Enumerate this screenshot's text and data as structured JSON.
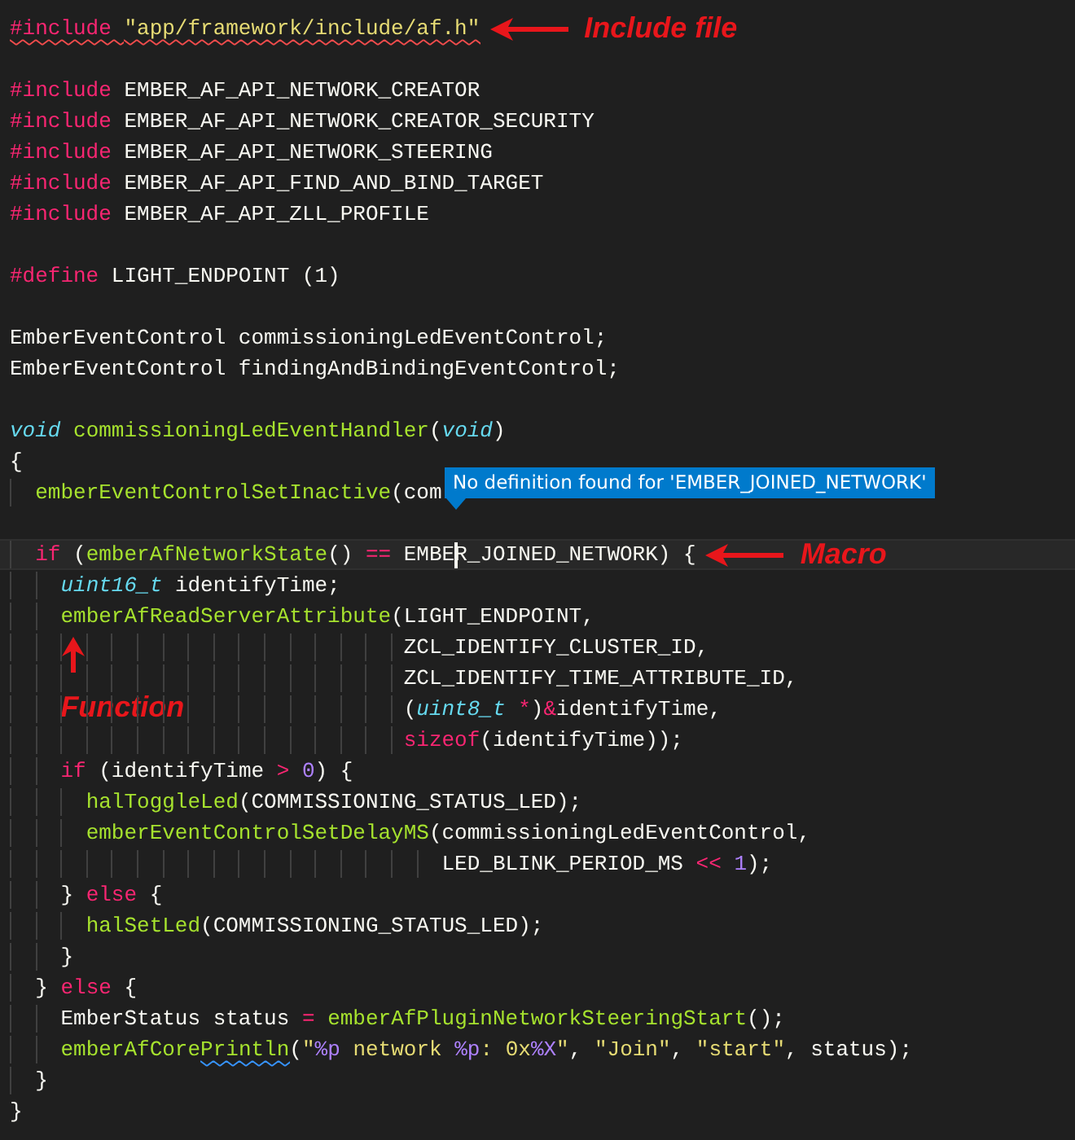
{
  "editor": {
    "lines": [
      {
        "kind": "code",
        "tokens": [
          {
            "text": "#include ",
            "kind": "directive",
            "error": true
          },
          {
            "text": "\"app/framework/include/af.h\"",
            "kind": "string",
            "error": true
          }
        ],
        "annotation": {
          "text": "Include file",
          "kind": "inline"
        }
      },
      {
        "kind": "blank"
      },
      {
        "kind": "code",
        "tokens": [
          {
            "text": "#include",
            "kind": "directive"
          },
          {
            "text": " EMBER_AF_API_NETWORK_CREATOR",
            "kind": "plain"
          }
        ]
      },
      {
        "kind": "code",
        "tokens": [
          {
            "text": "#include",
            "kind": "directive"
          },
          {
            "text": " EMBER_AF_API_NETWORK_CREATOR_SECURITY",
            "kind": "plain"
          }
        ]
      },
      {
        "kind": "code",
        "tokens": [
          {
            "text": "#include",
            "kind": "directive"
          },
          {
            "text": " EMBER_AF_API_NETWORK_STEERING",
            "kind": "plain"
          }
        ]
      },
      {
        "kind": "code",
        "tokens": [
          {
            "text": "#include",
            "kind": "directive"
          },
          {
            "text": " EMBER_AF_API_FIND_AND_BIND_TARGET",
            "kind": "plain"
          }
        ]
      },
      {
        "kind": "code",
        "tokens": [
          {
            "text": "#include",
            "kind": "directive"
          },
          {
            "text": " EMBER_AF_API_ZLL_PROFILE",
            "kind": "plain"
          }
        ]
      },
      {
        "kind": "blank"
      },
      {
        "kind": "code",
        "tokens": [
          {
            "text": "#define",
            "kind": "directive"
          },
          {
            "text": " LIGHT_ENDPOINT (1)",
            "kind": "plain"
          }
        ]
      },
      {
        "kind": "blank"
      },
      {
        "kind": "code",
        "tokens": [
          {
            "text": "EmberEventControl commissioningLedEventControl;",
            "kind": "plain"
          }
        ]
      },
      {
        "kind": "code",
        "tokens": [
          {
            "text": "EmberEventControl findingAndBindingEventControl;",
            "kind": "plain"
          }
        ]
      },
      {
        "kind": "blank"
      },
      {
        "kind": "code",
        "tokens": [
          {
            "text": "void ",
            "kind": "type"
          },
          {
            "text": "commissioningLedEventHandler",
            "kind": "function"
          },
          {
            "text": "(",
            "kind": "plain"
          },
          {
            "text": "void",
            "kind": "type"
          },
          {
            "text": ")",
            "kind": "plain"
          }
        ]
      },
      {
        "kind": "code",
        "tokens": [
          {
            "text": "{",
            "kind": "plain"
          }
        ]
      },
      {
        "kind": "code",
        "tokens": [
          {
            "text": "  emberEventControlSetInactive",
            "kind": "function"
          },
          {
            "text": "(com",
            "kind": "plain"
          }
        ]
      },
      {
        "kind": "blank"
      },
      {
        "kind": "code",
        "current": true,
        "tokens": [
          {
            "text": "  if",
            "kind": "keyword"
          },
          {
            "text": " (",
            "kind": "plain"
          },
          {
            "text": "emberAfNetworkState",
            "kind": "function"
          },
          {
            "text": "() ",
            "kind": "plain"
          },
          {
            "text": "==",
            "kind": "keyword"
          },
          {
            "text": " EMBE",
            "kind": "plain"
          },
          {
            "text": "R_JOINED_NETWORK) {",
            "kind": "plain",
            "cursor": true
          }
        ],
        "tooltip": "No definition found for 'EMBER_JOINED_NETWORK'",
        "annotation": {
          "text": "Macro",
          "kind": "inline"
        }
      },
      {
        "kind": "code",
        "tokens": [
          {
            "text": "    uint16_t",
            "kind": "type"
          },
          {
            "text": " identifyTime;",
            "kind": "plain"
          }
        ]
      },
      {
        "kind": "code",
        "tokens": [
          {
            "text": "    emberAfReadServerAttribute",
            "kind": "function"
          },
          {
            "text": "(LIGHT_ENDPOINT,",
            "kind": "plain"
          }
        ]
      },
      {
        "kind": "code",
        "tokens": [
          {
            "text": "                               ZCL_IDENTIFY_CLUSTER_ID,",
            "kind": "plain"
          }
        ],
        "annotation": {
          "text": "Function",
          "kind": "below"
        }
      },
      {
        "kind": "code",
        "tokens": [
          {
            "text": "                               ZCL_IDENTIFY_TIME_ATTRIBUTE_ID,",
            "kind": "plain"
          }
        ]
      },
      {
        "kind": "code",
        "tokens": [
          {
            "text": "                               (",
            "kind": "plain"
          },
          {
            "text": "uint8_t ",
            "kind": "type"
          },
          {
            "text": "*",
            "kind": "keyword"
          },
          {
            "text": ")",
            "kind": "plain"
          },
          {
            "text": "&",
            "kind": "keyword"
          },
          {
            "text": "identifyTime,",
            "kind": "plain"
          }
        ]
      },
      {
        "kind": "code",
        "tokens": [
          {
            "text": "                               sizeof",
            "kind": "keyword"
          },
          {
            "text": "(identifyTime));",
            "kind": "plain"
          }
        ]
      },
      {
        "kind": "code",
        "tokens": [
          {
            "text": "    if",
            "kind": "keyword"
          },
          {
            "text": " (identifyTime ",
            "kind": "plain"
          },
          {
            "text": "> ",
            "kind": "keyword"
          },
          {
            "text": "0",
            "kind": "number"
          },
          {
            "text": ") {",
            "kind": "plain"
          }
        ]
      },
      {
        "kind": "code",
        "tokens": [
          {
            "text": "      halToggleLed",
            "kind": "function"
          },
          {
            "text": "(COMMISSIONING_STATUS_LED);",
            "kind": "plain"
          }
        ]
      },
      {
        "kind": "code",
        "tokens": [
          {
            "text": "      emberEventControlSetDelayMS",
            "kind": "function"
          },
          {
            "text": "(commissioningLedEventControl,",
            "kind": "plain"
          }
        ]
      },
      {
        "kind": "code",
        "tokens": [
          {
            "text": "                                  LED_BLINK_PERIOD_MS ",
            "kind": "plain"
          },
          {
            "text": "<< ",
            "kind": "keyword"
          },
          {
            "text": "1",
            "kind": "number"
          },
          {
            "text": ");",
            "kind": "plain"
          }
        ]
      },
      {
        "kind": "code",
        "tokens": [
          {
            "text": "    } ",
            "kind": "plain"
          },
          {
            "text": "else",
            "kind": "keyword"
          },
          {
            "text": " {",
            "kind": "plain"
          }
        ]
      },
      {
        "kind": "code",
        "tokens": [
          {
            "text": "      halSetLed",
            "kind": "function"
          },
          {
            "text": "(COMMISSIONING_STATUS_LED);",
            "kind": "plain"
          }
        ]
      },
      {
        "kind": "code",
        "tokens": [
          {
            "text": "    }",
            "kind": "plain"
          }
        ]
      },
      {
        "kind": "code",
        "tokens": [
          {
            "text": "  } ",
            "kind": "plain"
          },
          {
            "text": "else",
            "kind": "keyword"
          },
          {
            "text": " {",
            "kind": "plain"
          }
        ]
      },
      {
        "kind": "code",
        "tokens": [
          {
            "text": "    EmberStatus status ",
            "kind": "plain"
          },
          {
            "text": "= ",
            "kind": "keyword"
          },
          {
            "text": "emberAfPluginNetworkSteeringStart",
            "kind": "function"
          },
          {
            "text": "();",
            "kind": "plain"
          }
        ]
      },
      {
        "kind": "code",
        "tokens": [
          {
            "text": "    emberAfCore",
            "kind": "function"
          },
          {
            "text": "Println",
            "kind": "function",
            "hint": true
          },
          {
            "text": "(",
            "kind": "plain"
          },
          {
            "text": "\"",
            "kind": "string"
          },
          {
            "text": "%p",
            "kind": "number"
          },
          {
            "text": " network ",
            "kind": "string"
          },
          {
            "text": "%p",
            "kind": "number"
          },
          {
            "text": ": 0x",
            "kind": "string"
          },
          {
            "text": "%X",
            "kind": "number"
          },
          {
            "text": "\"",
            "kind": "string"
          },
          {
            "text": ", ",
            "kind": "plain"
          },
          {
            "text": "\"Join\"",
            "kind": "string"
          },
          {
            "text": ", ",
            "kind": "plain"
          },
          {
            "text": "\"start\"",
            "kind": "string"
          },
          {
            "text": ", status);",
            "kind": "plain"
          }
        ]
      },
      {
        "kind": "code",
        "tokens": [
          {
            "text": "  }",
            "kind": "plain"
          }
        ]
      },
      {
        "kind": "code",
        "tokens": [
          {
            "text": "}",
            "kind": "plain"
          }
        ]
      }
    ]
  }
}
